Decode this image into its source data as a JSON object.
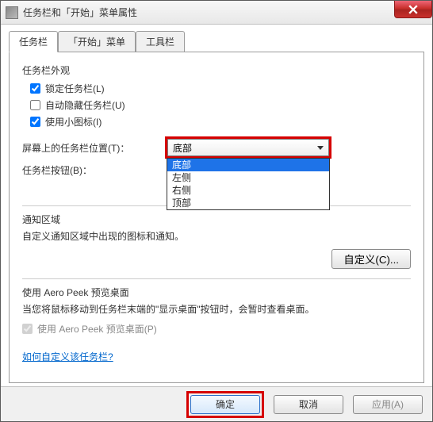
{
  "title": "任务栏和「开始」菜单属性",
  "tabs": [
    "任务栏",
    "「开始」菜单",
    "工具栏"
  ],
  "active_tab": 0,
  "appearance": {
    "group_title": "任务栏外观",
    "lock_taskbar": {
      "label": "锁定任务栏(L)",
      "checked": true
    },
    "auto_hide": {
      "label": "自动隐藏任务栏(U)",
      "checked": false
    },
    "small_icons": {
      "label": "使用小图标(I)",
      "checked": true
    }
  },
  "position": {
    "label": "屏幕上的任务栏位置(T)：",
    "selected": "底部",
    "options": [
      "底部",
      "左侧",
      "右侧",
      "顶部"
    ],
    "selected_index": 0
  },
  "buttons_field": {
    "label": "任务栏按钮(B)："
  },
  "notification": {
    "title": "通知区域",
    "text": "自定义通知区域中出现的图标和通知。",
    "customize_btn": "自定义(C)..."
  },
  "aero": {
    "title": "使用 Aero Peek 预览桌面",
    "text": "当您将鼠标移动到任务栏末端的\"显示桌面\"按钮时，会暂时查看桌面。",
    "checkbox": {
      "label": "使用 Aero Peek 预览桌面(P)",
      "checked": true,
      "disabled": true
    }
  },
  "help_link": "如何自定义该任务栏?",
  "footer": {
    "ok": "确定",
    "cancel": "取消",
    "apply": "应用(A)"
  }
}
